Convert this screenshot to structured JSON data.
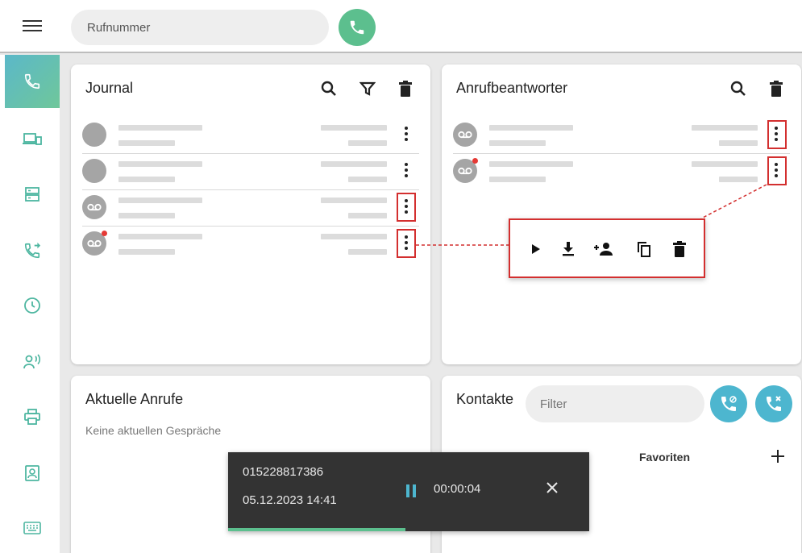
{
  "topbar": {
    "dial_placeholder": "Rufnummer"
  },
  "colors": {
    "accent_green": "#5cbf8e",
    "accent_teal": "#4db6cf",
    "highlight_red": "#d32f2f"
  },
  "sidebar": {
    "items": [
      {
        "icon": "phone-icon",
        "active": true
      },
      {
        "icon": "devices-icon"
      },
      {
        "icon": "storage-icon"
      },
      {
        "icon": "call-forward-icon"
      },
      {
        "icon": "clock-icon"
      },
      {
        "icon": "voice-icon"
      },
      {
        "icon": "printer-icon"
      },
      {
        "icon": "contact-card-icon"
      },
      {
        "icon": "keyboard-icon"
      }
    ]
  },
  "journal": {
    "title": "Journal"
  },
  "voicemail": {
    "title": "Anrufbeantworter"
  },
  "current_calls": {
    "title": "Aktuelle Anrufe",
    "empty_text": "Keine aktuellen Gespräche"
  },
  "contacts": {
    "title": "Kontakte",
    "filter_placeholder": "Filter",
    "favorites_label": "Favoriten"
  },
  "snackbar": {
    "number": "015228817386",
    "datetime": "05.12.2023 14:41",
    "duration": "00:00:04",
    "progress_fraction": 0.49
  }
}
